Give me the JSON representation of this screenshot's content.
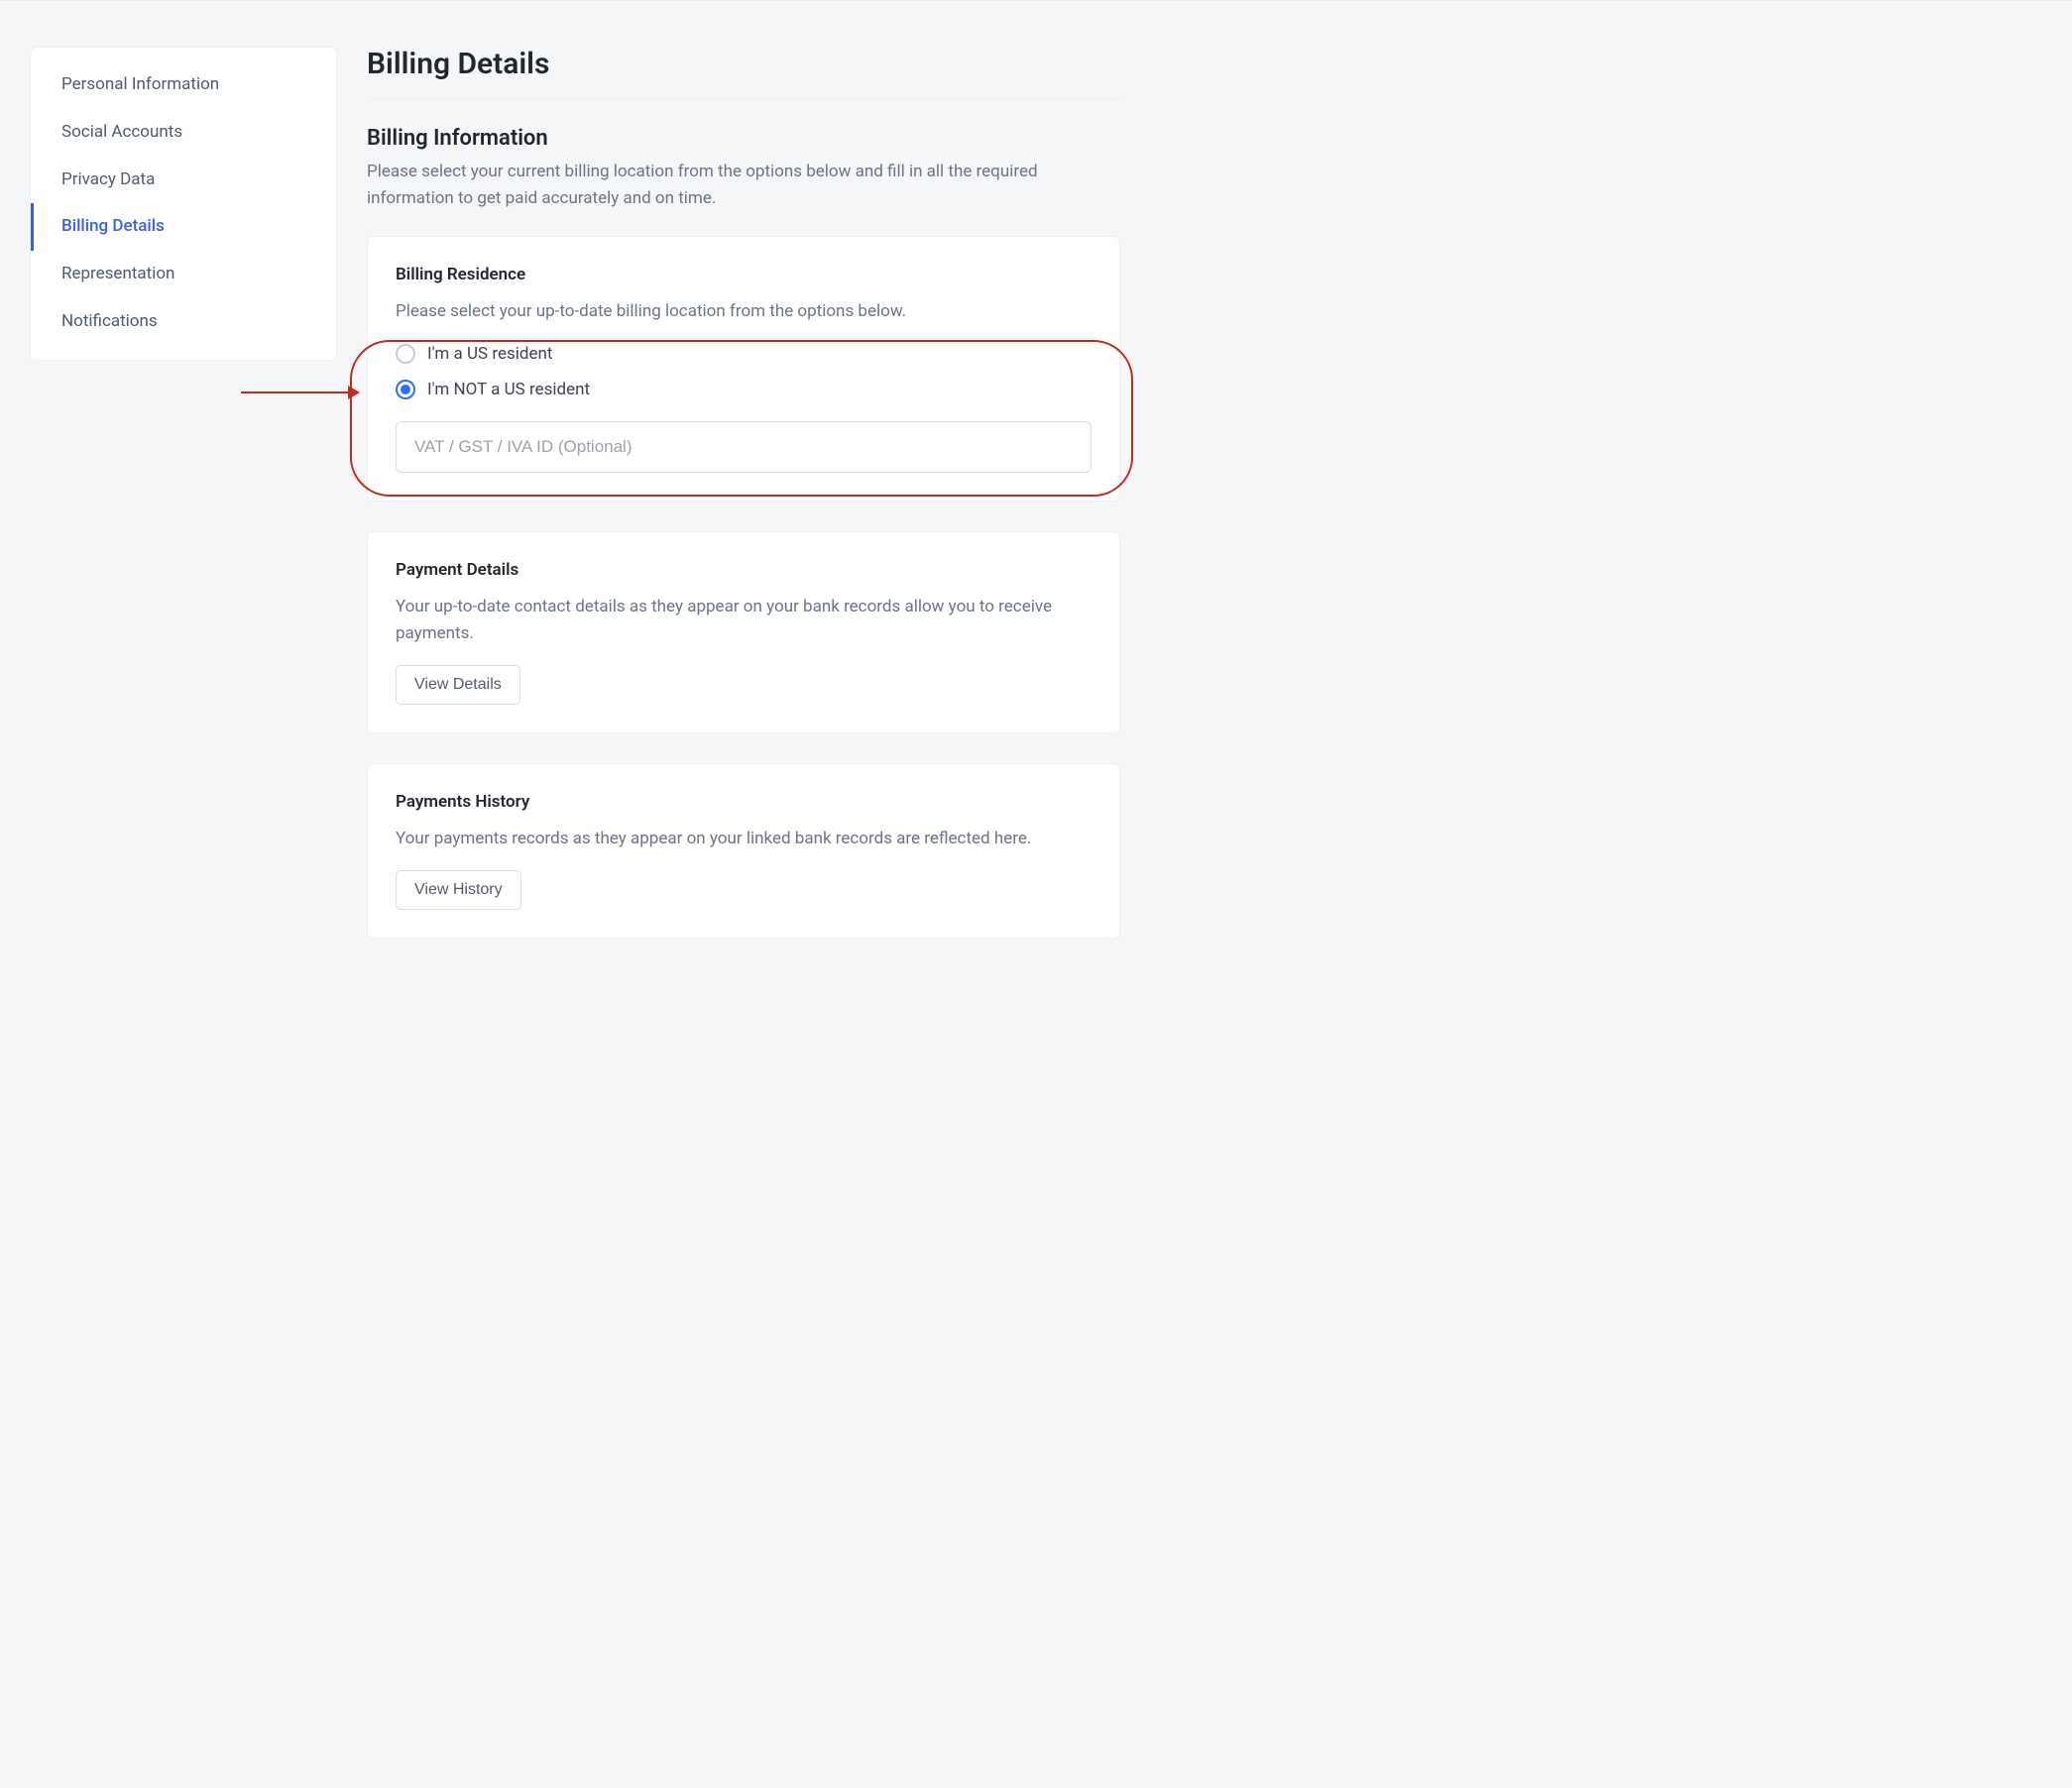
{
  "sidebar": {
    "items": [
      {
        "label": "Personal Information",
        "active": false
      },
      {
        "label": "Social Accounts",
        "active": false
      },
      {
        "label": "Privacy Data",
        "active": false
      },
      {
        "label": "Billing Details",
        "active": true
      },
      {
        "label": "Representation",
        "active": false
      },
      {
        "label": "Notifications",
        "active": false
      }
    ]
  },
  "main": {
    "title": "Billing Details",
    "billing_info": {
      "title": "Billing Information",
      "description": "Please select your current billing location from the options below and fill in all the required information to get paid accurately and on time."
    },
    "residence": {
      "title": "Billing Residence",
      "description": "Please select your up-to-date billing location from the options below.",
      "options": [
        {
          "label": "I'm a US resident",
          "selected": false
        },
        {
          "label": "I'm NOT a US resident",
          "selected": true
        }
      ],
      "vat_placeholder": "VAT / GST / IVA ID (Optional)",
      "vat_value": ""
    },
    "payment_details": {
      "title": "Payment Details",
      "description": "Your up-to-date contact details as they appear on your bank records allow you to receive payments.",
      "button": "View Details"
    },
    "payments_history": {
      "title": "Payments History",
      "description": "Your payments records as they appear on your linked bank records are reflected here.",
      "button": "View History"
    }
  }
}
